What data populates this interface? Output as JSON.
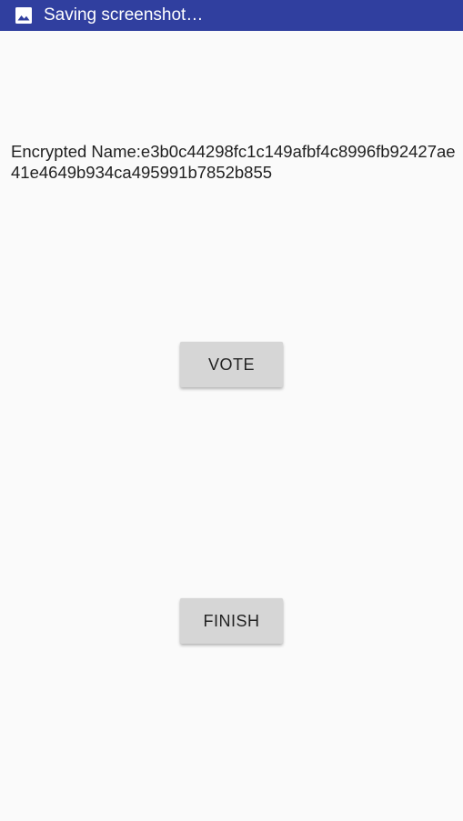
{
  "status_bar": {
    "icon": "image-icon",
    "text": "Saving screenshot…",
    "background": "#303f9f"
  },
  "main": {
    "encrypted_name": "Encrypted Name:e3b0c44298fc1c149afbf4c8996fb92427ae41e4649b934ca495991b7852b855",
    "vote_label": "VOTE",
    "finish_label": "FINISH"
  },
  "colors": {
    "background": "#fafafa",
    "button": "#d6d6d6",
    "text": "#212121"
  }
}
